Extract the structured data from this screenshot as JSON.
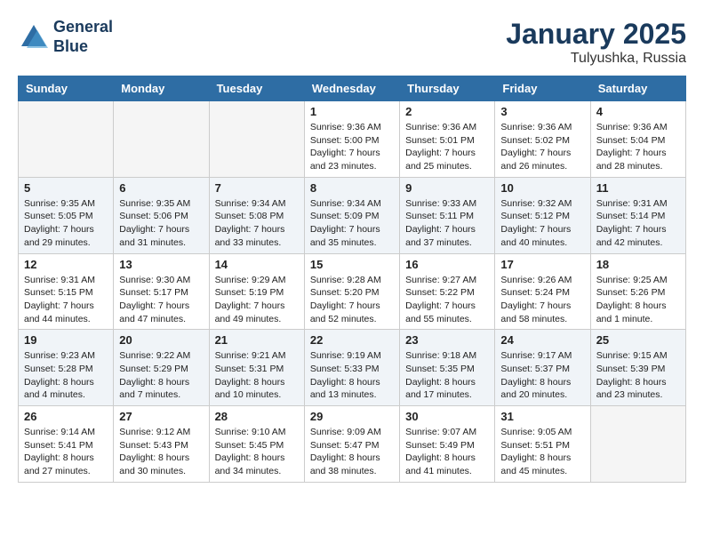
{
  "logo": {
    "line1": "General",
    "line2": "Blue"
  },
  "title": "January 2025",
  "location": "Tulyushka, Russia",
  "weekdays": [
    "Sunday",
    "Monday",
    "Tuesday",
    "Wednesday",
    "Thursday",
    "Friday",
    "Saturday"
  ],
  "weeks": [
    [
      {
        "day": "",
        "info": ""
      },
      {
        "day": "",
        "info": ""
      },
      {
        "day": "",
        "info": ""
      },
      {
        "day": "1",
        "info": "Sunrise: 9:36 AM\nSunset: 5:00 PM\nDaylight: 7 hours\nand 23 minutes."
      },
      {
        "day": "2",
        "info": "Sunrise: 9:36 AM\nSunset: 5:01 PM\nDaylight: 7 hours\nand 25 minutes."
      },
      {
        "day": "3",
        "info": "Sunrise: 9:36 AM\nSunset: 5:02 PM\nDaylight: 7 hours\nand 26 minutes."
      },
      {
        "day": "4",
        "info": "Sunrise: 9:36 AM\nSunset: 5:04 PM\nDaylight: 7 hours\nand 28 minutes."
      }
    ],
    [
      {
        "day": "5",
        "info": "Sunrise: 9:35 AM\nSunset: 5:05 PM\nDaylight: 7 hours\nand 29 minutes."
      },
      {
        "day": "6",
        "info": "Sunrise: 9:35 AM\nSunset: 5:06 PM\nDaylight: 7 hours\nand 31 minutes."
      },
      {
        "day": "7",
        "info": "Sunrise: 9:34 AM\nSunset: 5:08 PM\nDaylight: 7 hours\nand 33 minutes."
      },
      {
        "day": "8",
        "info": "Sunrise: 9:34 AM\nSunset: 5:09 PM\nDaylight: 7 hours\nand 35 minutes."
      },
      {
        "day": "9",
        "info": "Sunrise: 9:33 AM\nSunset: 5:11 PM\nDaylight: 7 hours\nand 37 minutes."
      },
      {
        "day": "10",
        "info": "Sunrise: 9:32 AM\nSunset: 5:12 PM\nDaylight: 7 hours\nand 40 minutes."
      },
      {
        "day": "11",
        "info": "Sunrise: 9:31 AM\nSunset: 5:14 PM\nDaylight: 7 hours\nand 42 minutes."
      }
    ],
    [
      {
        "day": "12",
        "info": "Sunrise: 9:31 AM\nSunset: 5:15 PM\nDaylight: 7 hours\nand 44 minutes."
      },
      {
        "day": "13",
        "info": "Sunrise: 9:30 AM\nSunset: 5:17 PM\nDaylight: 7 hours\nand 47 minutes."
      },
      {
        "day": "14",
        "info": "Sunrise: 9:29 AM\nSunset: 5:19 PM\nDaylight: 7 hours\nand 49 minutes."
      },
      {
        "day": "15",
        "info": "Sunrise: 9:28 AM\nSunset: 5:20 PM\nDaylight: 7 hours\nand 52 minutes."
      },
      {
        "day": "16",
        "info": "Sunrise: 9:27 AM\nSunset: 5:22 PM\nDaylight: 7 hours\nand 55 minutes."
      },
      {
        "day": "17",
        "info": "Sunrise: 9:26 AM\nSunset: 5:24 PM\nDaylight: 7 hours\nand 58 minutes."
      },
      {
        "day": "18",
        "info": "Sunrise: 9:25 AM\nSunset: 5:26 PM\nDaylight: 8 hours\nand 1 minute."
      }
    ],
    [
      {
        "day": "19",
        "info": "Sunrise: 9:23 AM\nSunset: 5:28 PM\nDaylight: 8 hours\nand 4 minutes."
      },
      {
        "day": "20",
        "info": "Sunrise: 9:22 AM\nSunset: 5:29 PM\nDaylight: 8 hours\nand 7 minutes."
      },
      {
        "day": "21",
        "info": "Sunrise: 9:21 AM\nSunset: 5:31 PM\nDaylight: 8 hours\nand 10 minutes."
      },
      {
        "day": "22",
        "info": "Sunrise: 9:19 AM\nSunset: 5:33 PM\nDaylight: 8 hours\nand 13 minutes."
      },
      {
        "day": "23",
        "info": "Sunrise: 9:18 AM\nSunset: 5:35 PM\nDaylight: 8 hours\nand 17 minutes."
      },
      {
        "day": "24",
        "info": "Sunrise: 9:17 AM\nSunset: 5:37 PM\nDaylight: 8 hours\nand 20 minutes."
      },
      {
        "day": "25",
        "info": "Sunrise: 9:15 AM\nSunset: 5:39 PM\nDaylight: 8 hours\nand 23 minutes."
      }
    ],
    [
      {
        "day": "26",
        "info": "Sunrise: 9:14 AM\nSunset: 5:41 PM\nDaylight: 8 hours\nand 27 minutes."
      },
      {
        "day": "27",
        "info": "Sunrise: 9:12 AM\nSunset: 5:43 PM\nDaylight: 8 hours\nand 30 minutes."
      },
      {
        "day": "28",
        "info": "Sunrise: 9:10 AM\nSunset: 5:45 PM\nDaylight: 8 hours\nand 34 minutes."
      },
      {
        "day": "29",
        "info": "Sunrise: 9:09 AM\nSunset: 5:47 PM\nDaylight: 8 hours\nand 38 minutes."
      },
      {
        "day": "30",
        "info": "Sunrise: 9:07 AM\nSunset: 5:49 PM\nDaylight: 8 hours\nand 41 minutes."
      },
      {
        "day": "31",
        "info": "Sunrise: 9:05 AM\nSunset: 5:51 PM\nDaylight: 8 hours\nand 45 minutes."
      },
      {
        "day": "",
        "info": ""
      }
    ]
  ]
}
